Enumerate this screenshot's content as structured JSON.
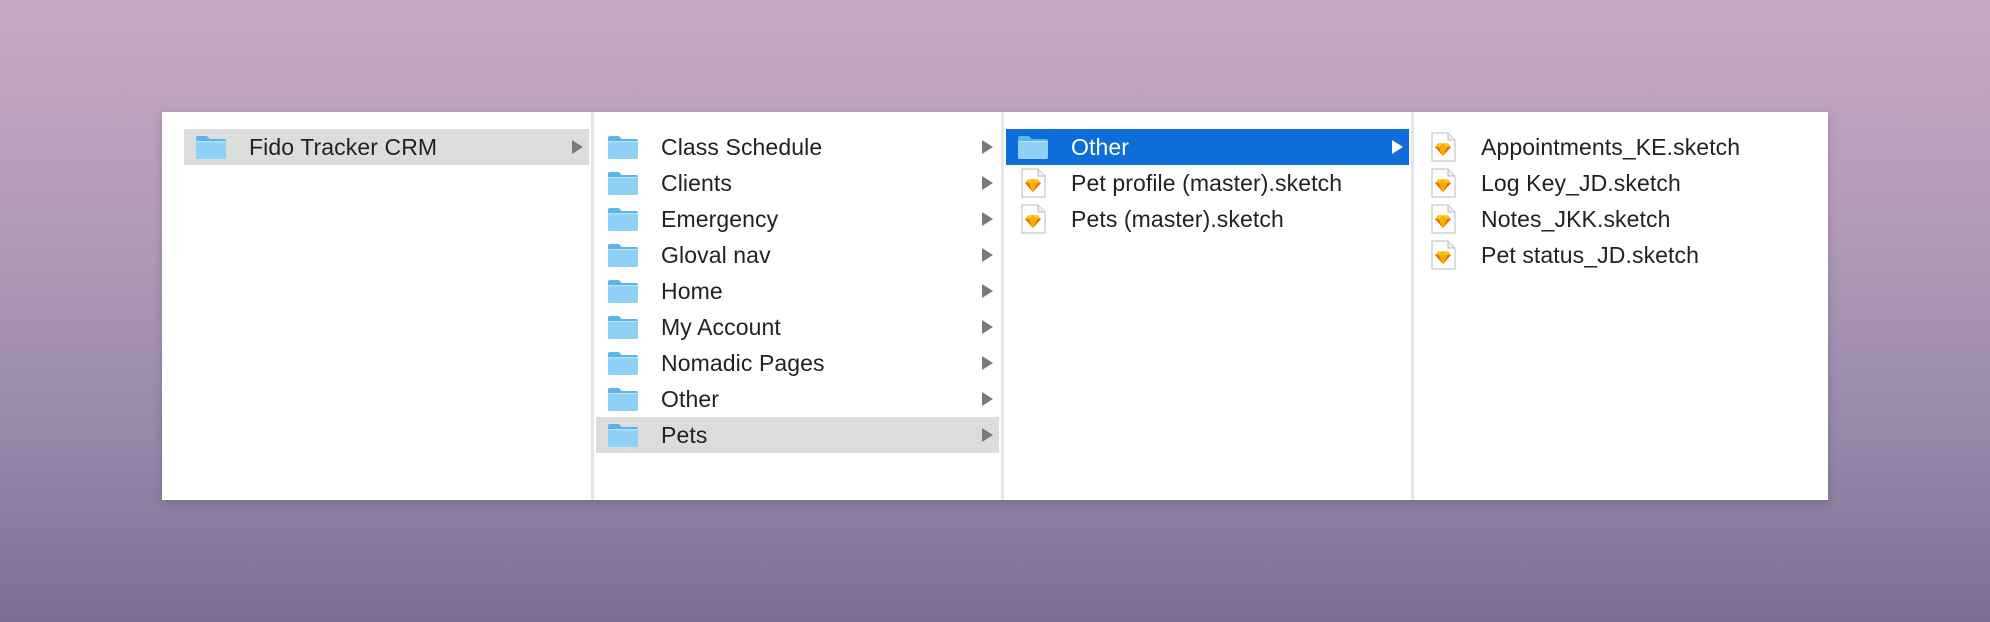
{
  "columns": [
    {
      "items": [
        {
          "label": "Fido Tracker CRM",
          "type": "folder",
          "chevron": true,
          "state": "inactive"
        }
      ]
    },
    {
      "items": [
        {
          "label": "Class Schedule",
          "type": "folder",
          "chevron": true,
          "state": ""
        },
        {
          "label": "Clients",
          "type": "folder",
          "chevron": true,
          "state": ""
        },
        {
          "label": "Emergency",
          "type": "folder",
          "chevron": true,
          "state": ""
        },
        {
          "label": "Gloval nav",
          "type": "folder",
          "chevron": true,
          "state": ""
        },
        {
          "label": "Home",
          "type": "folder",
          "chevron": true,
          "state": ""
        },
        {
          "label": "My Account",
          "type": "folder",
          "chevron": true,
          "state": ""
        },
        {
          "label": "Nomadic Pages",
          "type": "folder",
          "chevron": true,
          "state": ""
        },
        {
          "label": "Other",
          "type": "folder",
          "chevron": true,
          "state": ""
        },
        {
          "label": "Pets",
          "type": "folder",
          "chevron": true,
          "state": "inactive"
        }
      ]
    },
    {
      "items": [
        {
          "label": "Other",
          "type": "folder",
          "chevron": true,
          "state": "active"
        },
        {
          "label": "Pet profile (master).sketch",
          "type": "sketch",
          "chevron": false,
          "state": ""
        },
        {
          "label": "Pets (master).sketch",
          "type": "sketch",
          "chevron": false,
          "state": ""
        }
      ]
    },
    {
      "items": [
        {
          "label": "Appointments_KE.sketch",
          "type": "sketch",
          "chevron": false,
          "state": ""
        },
        {
          "label": "Log Key_JD.sketch",
          "type": "sketch",
          "chevron": false,
          "state": ""
        },
        {
          "label": "Notes_JKK.sketch",
          "type": "sketch",
          "chevron": false,
          "state": ""
        },
        {
          "label": "Pet status_JD.sketch",
          "type": "sketch",
          "chevron": false,
          "state": ""
        }
      ]
    }
  ],
  "colors": {
    "selection_active": "#0d6dd9",
    "selection_inactive": "#dcdcdc",
    "folder": "#7cc4f0",
    "sketch_diamond": "#f7b500"
  }
}
